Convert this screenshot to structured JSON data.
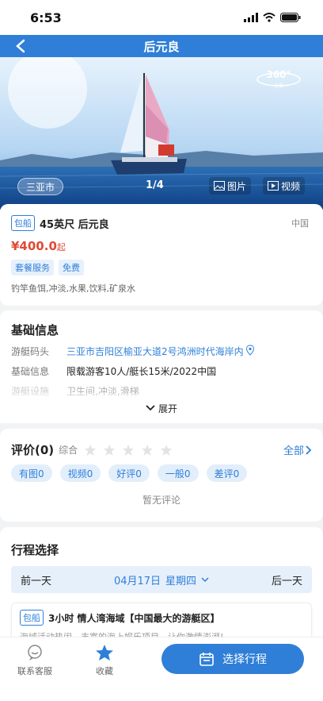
{
  "status": {
    "time": "6:53"
  },
  "nav": {
    "title": "后元良"
  },
  "hero": {
    "badge_360_top": "360°",
    "badge_360_bottom": "全景",
    "city": "三亚市",
    "counter": "1/4",
    "photos_label": "图片",
    "video_label": "视频"
  },
  "product": {
    "tag": "包船",
    "title": "45英尺 后元良",
    "country": "中国",
    "price": "¥400.0",
    "price_unit": "起",
    "tags": [
      "套餐服务",
      "免费"
    ],
    "description": "钓竿鱼饵,冲淡,水果,饮料,矿泉水"
  },
  "info": {
    "title": "基础信息",
    "rows": [
      {
        "label": "游艇码头",
        "value": "三亚市吉阳区榆亚大道2号鸿洲时代海岸内"
      },
      {
        "label": "基础信息",
        "value": "限载游客10人/艇长15米/2022中国"
      },
      {
        "label": "游艇设施",
        "value": "卫生间,冲淡,滑梯"
      }
    ],
    "expand_label": "展开"
  },
  "reviews": {
    "title": "评价(0)",
    "overall_label": "综合",
    "rating": 0,
    "all_label": "全部",
    "filters": [
      "有图0",
      "视频0",
      "好评0",
      "一般0",
      "差评0"
    ],
    "empty": "暂无评论"
  },
  "schedule": {
    "title": "行程选择",
    "prev_day": "前一天",
    "date": "04月17日",
    "weekday": "星期四",
    "next_day": "后一天",
    "trip": {
      "tag": "包船",
      "title": "3小时 情人湾海域【中国最大的游艇区】",
      "description": "海域活动热闹，丰富的海上娱乐项目，让你激情澎湃!"
    }
  },
  "bottom": {
    "service_label": "联系客服",
    "favorite_label": "收藏",
    "cta_label": "选择行程"
  },
  "colors": {
    "primary": "#2f7fd8",
    "price": "#e04a35"
  }
}
